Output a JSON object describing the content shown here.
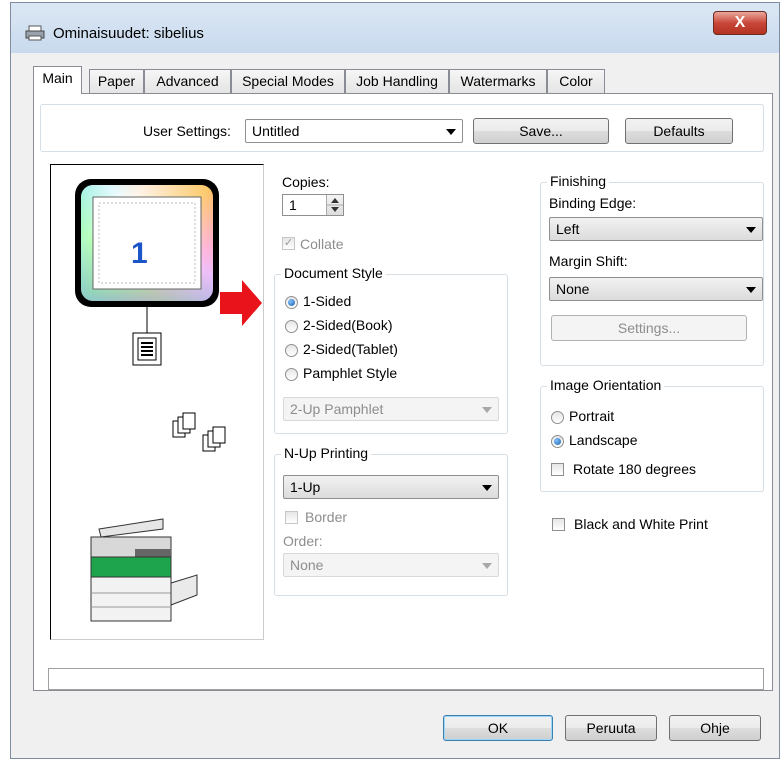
{
  "window": {
    "title": "Ominaisuudet: sibelius",
    "close_label": "X",
    "title_icon": "printer-icon"
  },
  "tabs": [
    {
      "label": "Main",
      "active": true
    },
    {
      "label": "Paper",
      "active": false
    },
    {
      "label": "Advanced",
      "active": false
    },
    {
      "label": "Special Modes",
      "active": false
    },
    {
      "label": "Job Handling",
      "active": false
    },
    {
      "label": "Watermarks",
      "active": false
    },
    {
      "label": "Color",
      "active": false
    }
  ],
  "user_settings": {
    "label": "User Settings:",
    "value": "Untitled",
    "save_label": "Save...",
    "defaults_label": "Defaults"
  },
  "preview": {
    "page_number": "1"
  },
  "copies": {
    "label": "Copies:",
    "value": "1",
    "collate_label": "Collate",
    "collate_checked": true
  },
  "document_style": {
    "title": "Document Style",
    "options": [
      "1-Sided",
      "2-Sided(Book)",
      "2-Sided(Tablet)",
      "Pamphlet Style"
    ],
    "selected": "1-Sided",
    "pamphlet_value": "2-Up Pamphlet"
  },
  "nup": {
    "title": "N-Up Printing",
    "value": "1-Up",
    "border_label": "Border",
    "order_label": "Order:",
    "order_value": "None"
  },
  "finishing": {
    "title": "Finishing",
    "binding_edge_label": "Binding Edge:",
    "binding_edge_value": "Left",
    "margin_shift_label": "Margin Shift:",
    "margin_shift_value": "None",
    "settings_label": "Settings..."
  },
  "orientation": {
    "title": "Image Orientation",
    "options": [
      "Portrait",
      "Landscape"
    ],
    "selected": "Landscape",
    "rotate_label": "Rotate 180 degrees"
  },
  "bw_print_label": "Black and White Print",
  "footer": {
    "ok_label": "OK",
    "cancel_label": "Peruuta",
    "help_label": "Ohje"
  },
  "colors": {
    "arrow": "#e8131b",
    "page_number": "#1c55c7"
  }
}
